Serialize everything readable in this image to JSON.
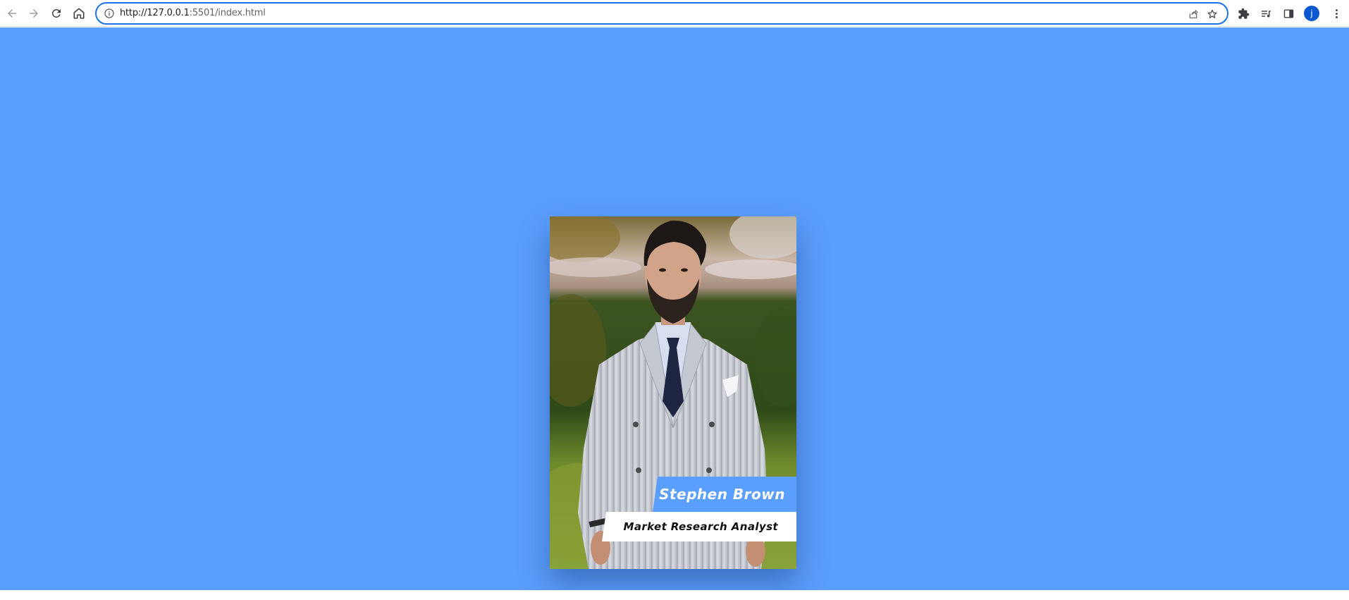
{
  "browser": {
    "url_host": "http://127.0.0.1",
    "url_rest": ":5501/index.html",
    "avatar_letter": "j",
    "icons": [
      "back-arrow-icon",
      "forward-arrow-icon",
      "reload-icon",
      "home-icon",
      "info-icon",
      "share-icon",
      "star-icon",
      "extensions-icon",
      "reading-list-icon",
      "side-panel-icon",
      "more-menu-icon"
    ]
  },
  "page": {
    "background_color": "#5b9ffe"
  },
  "card": {
    "name": "Stephen Brown",
    "role": "Market Research Analyst",
    "accent_color": "#5b9ffe"
  }
}
